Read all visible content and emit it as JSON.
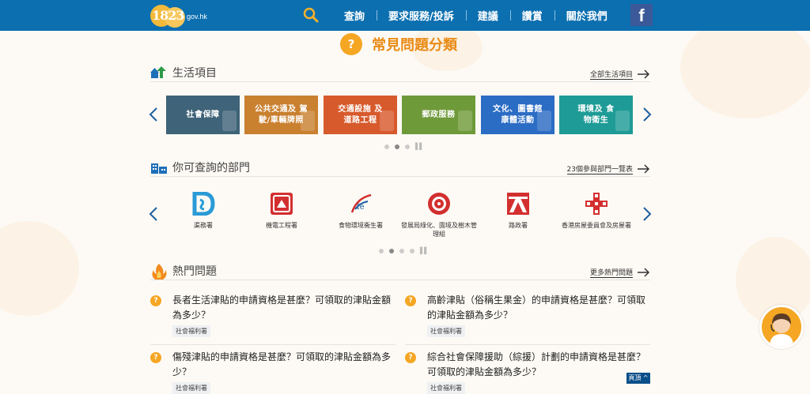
{
  "header": {
    "logo_text": "1823",
    "logo_domain": "gov.hk",
    "nav": [
      {
        "label": "查詢"
      },
      {
        "label": "要求服務/投訴"
      },
      {
        "label": "建議"
      },
      {
        "label": "讚賞"
      },
      {
        "label": "關於我們"
      }
    ],
    "facebook_label": "f"
  },
  "page": {
    "title": "常見問題分類",
    "title_badge": "?"
  },
  "life": {
    "title": "生活項目",
    "more_link": "全部生活項目",
    "tiles": [
      {
        "label": "社會保障",
        "color": "#3f6378"
      },
      {
        "label": "公共交通及 駕駛/車輛牌照",
        "color": "#c9802f"
      },
      {
        "label": "交通設施 及道路工程",
        "color": "#d75a2c"
      },
      {
        "label": "郵政服務",
        "color": "#6f9a3a"
      },
      {
        "label": "文化、圖書館 康體活動",
        "color": "#2b6cc4"
      },
      {
        "label": "環境及 食物衛生",
        "color": "#1e9b96"
      }
    ]
  },
  "departments": {
    "title": "你可查詢的部門",
    "more_link": "23個參與部門一覽表",
    "items": [
      {
        "name": "渠務署"
      },
      {
        "name": "機電工程署"
      },
      {
        "name": "食物環境衞生署"
      },
      {
        "name": "發展局綠化、園境及樹木管理組"
      },
      {
        "name": "路政署"
      },
      {
        "name": "香港房屋委員會及房屋署"
      }
    ]
  },
  "hot": {
    "title": "熱門問題",
    "more_link": "更多熱門問題",
    "questions": [
      {
        "text": "長者生活津貼的申請資格是甚麼？可領取的津貼金額為多少？",
        "tag": "社會福利署"
      },
      {
        "text": "高齡津貼（俗稱生果金）的申請資格是甚麼？可領取的津貼金額為多少？",
        "tag": "社會福利署"
      },
      {
        "text": "傷殘津貼的申請資格是甚麼？可領取的津貼金額為多少？",
        "tag": "社會福利署"
      },
      {
        "text": "綜合社會保障援助（綜援）計劃的申請資格是甚麼？可領取的津貼金額為多少？",
        "tag": "社會福利署"
      }
    ]
  },
  "back_to_top": "頁頂 ^"
}
